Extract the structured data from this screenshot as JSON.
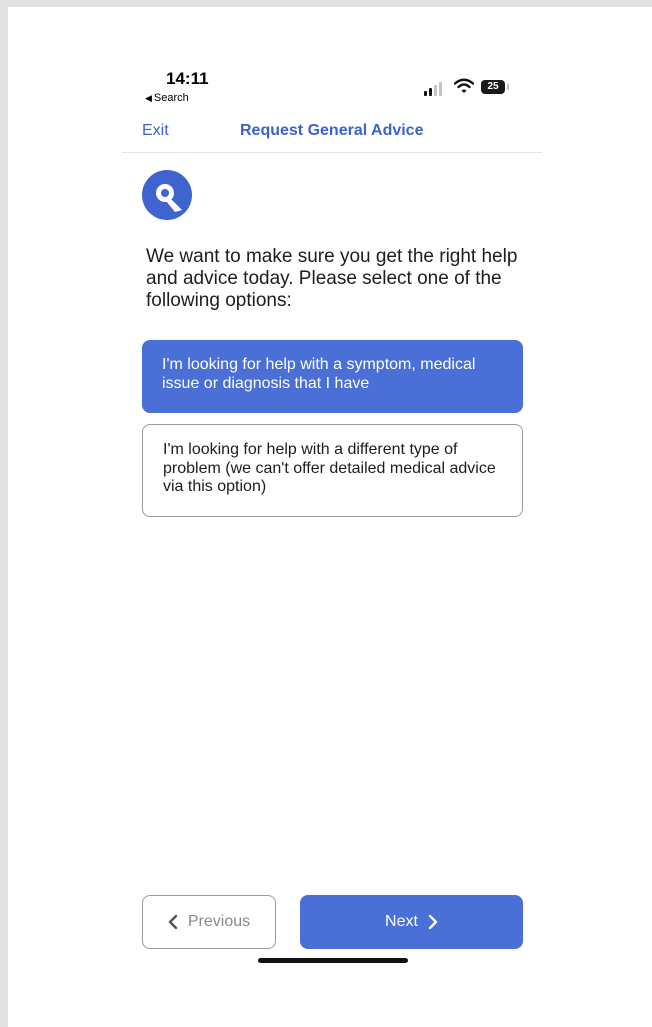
{
  "status_bar": {
    "time": "14:11",
    "back_label": "Search",
    "back_glyph": "◀",
    "battery": "25"
  },
  "nav": {
    "exit_label": "Exit",
    "title": "Request General Advice"
  },
  "intro_text": "We want to make sure you get the right help and advice today. Please select one of the following options:",
  "options": [
    {
      "label": "I'm looking for help with a symptom, medical issue or diagnosis that I have",
      "selected": true
    },
    {
      "label": "I'm looking for help with a different type of problem (we can't offer detailed medical advice via this option)",
      "selected": false
    }
  ],
  "buttons": {
    "previous_label": "Previous",
    "next_label": "Next"
  },
  "icons": [
    "back-triangle-icon",
    "signal-icon",
    "wifi-icon",
    "battery-icon",
    "app-logo",
    "chevron-left-icon",
    "chevron-right-icon"
  ],
  "colors": {
    "accent": "#4a6fd6",
    "link": "#3b63c8",
    "text": "#1d1d1f",
    "border": "#9a9a9a"
  }
}
